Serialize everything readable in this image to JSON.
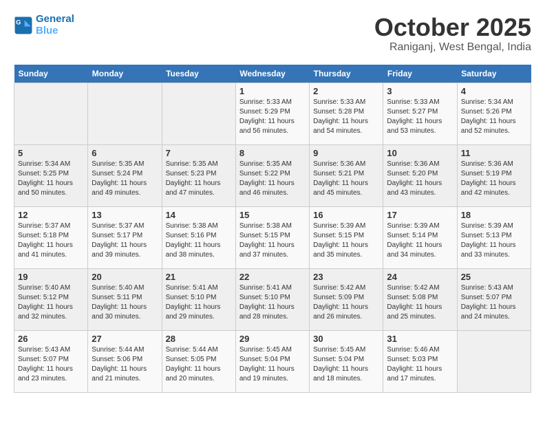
{
  "header": {
    "logo_line1": "General",
    "logo_line2": "Blue",
    "month_title": "October 2025",
    "subtitle": "Raniganj, West Bengal, India"
  },
  "weekdays": [
    "Sunday",
    "Monday",
    "Tuesday",
    "Wednesday",
    "Thursday",
    "Friday",
    "Saturday"
  ],
  "weeks": [
    [
      {
        "day": "",
        "info": ""
      },
      {
        "day": "",
        "info": ""
      },
      {
        "day": "",
        "info": ""
      },
      {
        "day": "1",
        "info": "Sunrise: 5:33 AM\nSunset: 5:29 PM\nDaylight: 11 hours\nand 56 minutes."
      },
      {
        "day": "2",
        "info": "Sunrise: 5:33 AM\nSunset: 5:28 PM\nDaylight: 11 hours\nand 54 minutes."
      },
      {
        "day": "3",
        "info": "Sunrise: 5:33 AM\nSunset: 5:27 PM\nDaylight: 11 hours\nand 53 minutes."
      },
      {
        "day": "4",
        "info": "Sunrise: 5:34 AM\nSunset: 5:26 PM\nDaylight: 11 hours\nand 52 minutes."
      }
    ],
    [
      {
        "day": "5",
        "info": "Sunrise: 5:34 AM\nSunset: 5:25 PM\nDaylight: 11 hours\nand 50 minutes."
      },
      {
        "day": "6",
        "info": "Sunrise: 5:35 AM\nSunset: 5:24 PM\nDaylight: 11 hours\nand 49 minutes."
      },
      {
        "day": "7",
        "info": "Sunrise: 5:35 AM\nSunset: 5:23 PM\nDaylight: 11 hours\nand 47 minutes."
      },
      {
        "day": "8",
        "info": "Sunrise: 5:35 AM\nSunset: 5:22 PM\nDaylight: 11 hours\nand 46 minutes."
      },
      {
        "day": "9",
        "info": "Sunrise: 5:36 AM\nSunset: 5:21 PM\nDaylight: 11 hours\nand 45 minutes."
      },
      {
        "day": "10",
        "info": "Sunrise: 5:36 AM\nSunset: 5:20 PM\nDaylight: 11 hours\nand 43 minutes."
      },
      {
        "day": "11",
        "info": "Sunrise: 5:36 AM\nSunset: 5:19 PM\nDaylight: 11 hours\nand 42 minutes."
      }
    ],
    [
      {
        "day": "12",
        "info": "Sunrise: 5:37 AM\nSunset: 5:18 PM\nDaylight: 11 hours\nand 41 minutes."
      },
      {
        "day": "13",
        "info": "Sunrise: 5:37 AM\nSunset: 5:17 PM\nDaylight: 11 hours\nand 39 minutes."
      },
      {
        "day": "14",
        "info": "Sunrise: 5:38 AM\nSunset: 5:16 PM\nDaylight: 11 hours\nand 38 minutes."
      },
      {
        "day": "15",
        "info": "Sunrise: 5:38 AM\nSunset: 5:15 PM\nDaylight: 11 hours\nand 37 minutes."
      },
      {
        "day": "16",
        "info": "Sunrise: 5:39 AM\nSunset: 5:15 PM\nDaylight: 11 hours\nand 35 minutes."
      },
      {
        "day": "17",
        "info": "Sunrise: 5:39 AM\nSunset: 5:14 PM\nDaylight: 11 hours\nand 34 minutes."
      },
      {
        "day": "18",
        "info": "Sunrise: 5:39 AM\nSunset: 5:13 PM\nDaylight: 11 hours\nand 33 minutes."
      }
    ],
    [
      {
        "day": "19",
        "info": "Sunrise: 5:40 AM\nSunset: 5:12 PM\nDaylight: 11 hours\nand 32 minutes."
      },
      {
        "day": "20",
        "info": "Sunrise: 5:40 AM\nSunset: 5:11 PM\nDaylight: 11 hours\nand 30 minutes."
      },
      {
        "day": "21",
        "info": "Sunrise: 5:41 AM\nSunset: 5:10 PM\nDaylight: 11 hours\nand 29 minutes."
      },
      {
        "day": "22",
        "info": "Sunrise: 5:41 AM\nSunset: 5:10 PM\nDaylight: 11 hours\nand 28 minutes."
      },
      {
        "day": "23",
        "info": "Sunrise: 5:42 AM\nSunset: 5:09 PM\nDaylight: 11 hours\nand 26 minutes."
      },
      {
        "day": "24",
        "info": "Sunrise: 5:42 AM\nSunset: 5:08 PM\nDaylight: 11 hours\nand 25 minutes."
      },
      {
        "day": "25",
        "info": "Sunrise: 5:43 AM\nSunset: 5:07 PM\nDaylight: 11 hours\nand 24 minutes."
      }
    ],
    [
      {
        "day": "26",
        "info": "Sunrise: 5:43 AM\nSunset: 5:07 PM\nDaylight: 11 hours\nand 23 minutes."
      },
      {
        "day": "27",
        "info": "Sunrise: 5:44 AM\nSunset: 5:06 PM\nDaylight: 11 hours\nand 21 minutes."
      },
      {
        "day": "28",
        "info": "Sunrise: 5:44 AM\nSunset: 5:05 PM\nDaylight: 11 hours\nand 20 minutes."
      },
      {
        "day": "29",
        "info": "Sunrise: 5:45 AM\nSunset: 5:04 PM\nDaylight: 11 hours\nand 19 minutes."
      },
      {
        "day": "30",
        "info": "Sunrise: 5:45 AM\nSunset: 5:04 PM\nDaylight: 11 hours\nand 18 minutes."
      },
      {
        "day": "31",
        "info": "Sunrise: 5:46 AM\nSunset: 5:03 PM\nDaylight: 11 hours\nand 17 minutes."
      },
      {
        "day": "",
        "info": ""
      }
    ]
  ]
}
